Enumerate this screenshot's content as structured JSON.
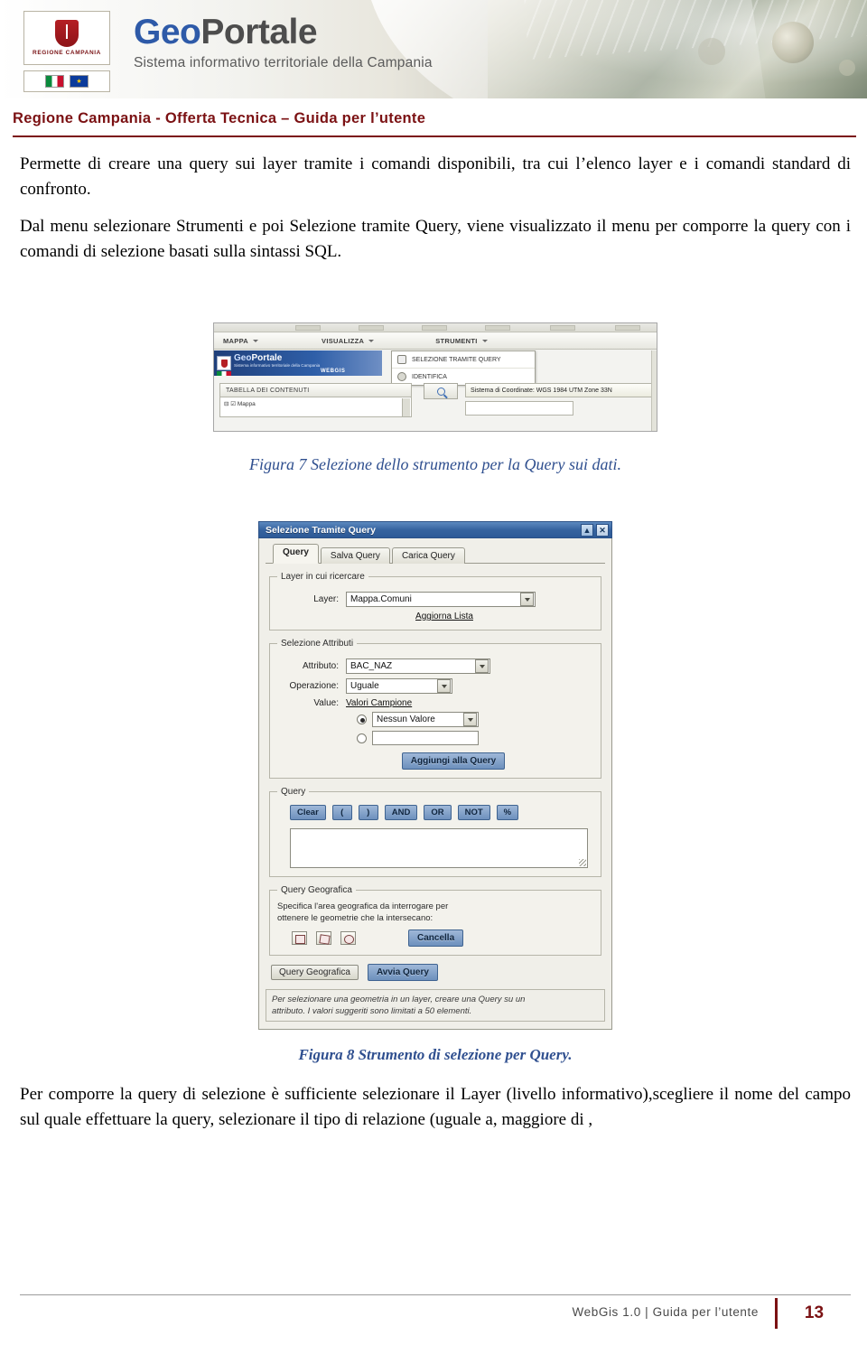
{
  "banner": {
    "logo_geo": "Geo",
    "logo_portale": "Portale",
    "logo_subtitle": "Sistema informativo territoriale della Campania",
    "crest_text": "REGIONE CAMPANIA"
  },
  "document": {
    "title": "Regione Campania - Offerta Tecnica – Guida per l’utente",
    "paragraph_1": "Permette di creare una query sui layer tramite i comandi disponibili, tra cui l’elenco layer e i comandi standard di confronto.",
    "paragraph_2": "Dal menu selezionare Strumenti e poi Selezione tramite Query, viene visualizzato il menu per comporre la query con i comandi di selezione basati sulla sintassi SQL.",
    "paragraph_3": "Per comporre la query di selezione è sufficiente selezionare il Layer (livello informativo),scegliere il nome del campo sul quale effettuare la query, selezionare il tipo di relazione (uguale a, maggiore di ,"
  },
  "figure7": {
    "caption": "Figura 7 Selezione dello strumento per la Query sui dati.",
    "menus": [
      "MAPPA",
      "VISUALIZZA",
      "STRUMENTI"
    ],
    "dropdown_items": [
      "SELEZIONE TRAMITE QUERY",
      "IDENTIFICA"
    ],
    "logo_geo": "Geo",
    "logo_portale": "Portale",
    "logo_subtitle": "Sistema informativo territoriale della Campania",
    "logo_webgis": "WEBGIS",
    "contents_title": "TABELLA DEI CONTENUTI",
    "contents_item": "Mappa",
    "coordinate_bar": "Sistema di Coordinate: WGS 1984 UTM Zone 33N"
  },
  "figure8": {
    "caption": "Figura 8 Strumento di selezione per Query.",
    "window_title": "Selezione Tramite Query",
    "window_buttons": [
      "▲",
      "✕"
    ],
    "tabs": [
      {
        "label": "Query",
        "active": true
      },
      {
        "label": "Salva Query",
        "active": false
      },
      {
        "label": "Carica Query",
        "active": false
      }
    ],
    "group_layer": {
      "legend": "Layer in cui ricercare",
      "layer_label": "Layer:",
      "layer_value": "Mappa.Comuni",
      "refresh_link": "Aggiorna Lista"
    },
    "group_attributes": {
      "legend": "Selezione Attributi",
      "attribute_label": "Attributo:",
      "attribute_value": "BAC_NAZ",
      "operation_label": "Operazione:",
      "operation_value": "Uguale",
      "value_label": "Value:",
      "sample_values_link": "Valori Campione",
      "sample_value_selected": "Nessun Valore",
      "custom_value": "",
      "add_button": "Aggiungi alla Query"
    },
    "group_query": {
      "legend": "Query",
      "buttons": [
        "Clear",
        "(",
        ")",
        "AND",
        "OR",
        "NOT",
        "%"
      ],
      "textarea_value": ""
    },
    "group_geo": {
      "legend": "Query Geografica",
      "note_line_1": "Specifica l'area geografica da interrogare per",
      "note_line_2": "ottenere le geometrie che la intersecano:",
      "cancel_button": "Cancella",
      "icons": [
        "draw-point-icon",
        "draw-rectangle-icon",
        "draw-polygon-icon"
      ]
    },
    "footer_buttons": [
      "Query Geografica",
      "Avvia Query"
    ],
    "status_line_1": "Per selezionare una geometria in un layer, creare una Query su un",
    "status_line_2": "attributo. I valori suggeriti sono limitati a 50 elementi."
  },
  "footer": {
    "text": "WebGis 1.0  |  Guida per l’utente",
    "page_number": "13"
  }
}
